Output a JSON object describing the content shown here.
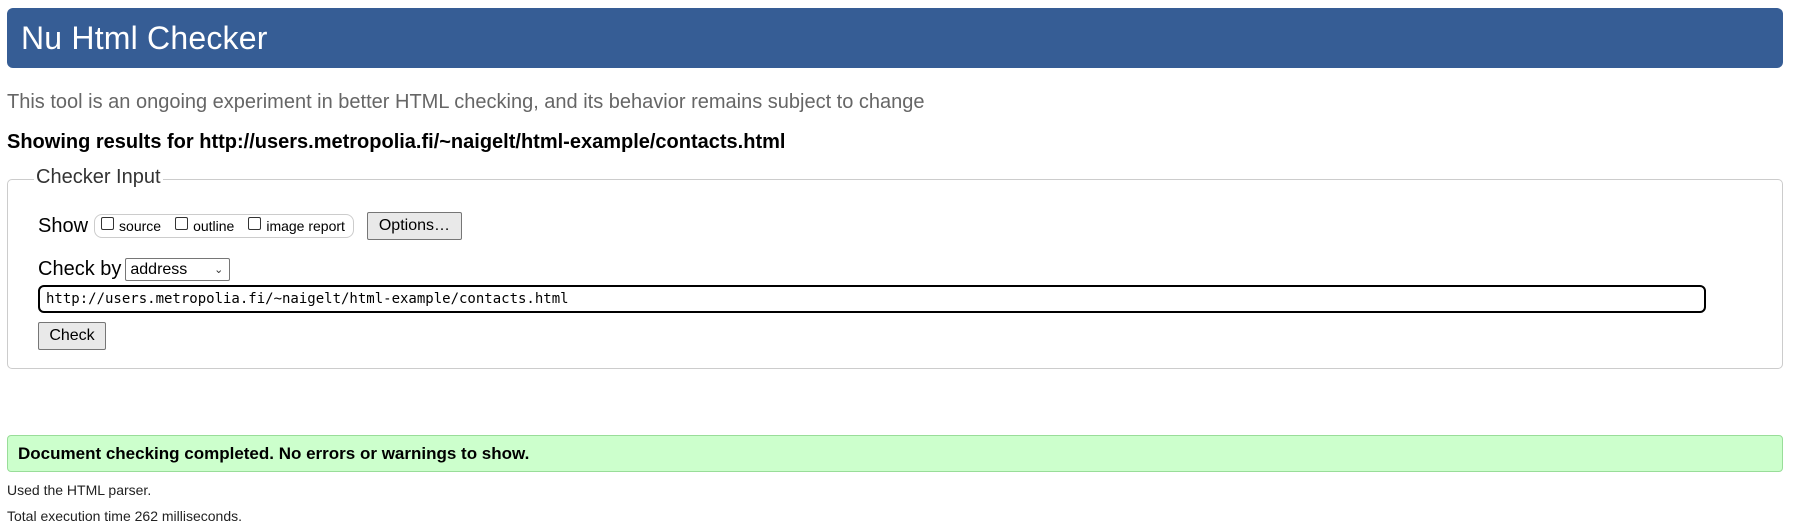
{
  "header": {
    "title": "Nu Html Checker"
  },
  "subtitle": "This tool is an ongoing experiment in better HTML checking, and its behavior remains subject to change",
  "results_for": "Showing results for http://users.metropolia.fi/~naigelt/html-example/contacts.html",
  "checker_input": {
    "legend": "Checker Input",
    "show_label": "Show",
    "checkboxes": [
      {
        "label": "source",
        "checked": false
      },
      {
        "label": "outline",
        "checked": false
      },
      {
        "label": "image report",
        "checked": false
      }
    ],
    "options_button": "Options…",
    "check_by_label": "Check by",
    "check_by_selected": "address",
    "url_value": "http://users.metropolia.fi/~naigelt/html-example/contacts.html",
    "check_button": "Check"
  },
  "result": {
    "message": "Document checking completed. No errors or warnings to show.",
    "parser_note": "Used the HTML parser.",
    "execution_time": "Total execution time 262 milliseconds."
  },
  "colors": {
    "header_bg": "#365d95",
    "success_bg": "#ccffcc"
  }
}
